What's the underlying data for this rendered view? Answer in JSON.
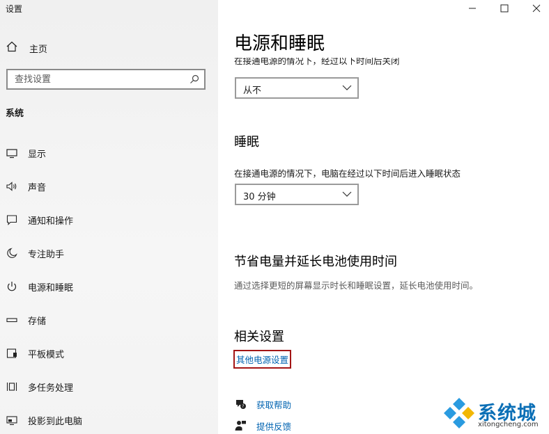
{
  "window": {
    "title": "设置"
  },
  "sidebar": {
    "home_label": "主页",
    "search_placeholder": "查找设置",
    "section_title": "系统",
    "items": [
      {
        "label": "显示",
        "icon": "display-icon"
      },
      {
        "label": "声音",
        "icon": "speaker-icon"
      },
      {
        "label": "通知和操作",
        "icon": "notification-icon"
      },
      {
        "label": "专注助手",
        "icon": "moon-icon"
      },
      {
        "label": "电源和睡眠",
        "icon": "power-icon"
      },
      {
        "label": "存储",
        "icon": "storage-icon"
      },
      {
        "label": "平板模式",
        "icon": "tablet-icon"
      },
      {
        "label": "多任务处理",
        "icon": "multitask-icon"
      },
      {
        "label": "投影到此电脑",
        "icon": "project-icon"
      }
    ]
  },
  "main": {
    "title": "电源和睡眠",
    "screen_desc_cut": "在接通电源的情况下，经过以下时间后关闭",
    "screen_select": "从不",
    "sleep_heading": "睡眠",
    "sleep_desc": "在接通电源的情况下，电脑在经过以下时间后进入睡眠状态",
    "sleep_select": "30 分钟",
    "battery_heading": "节省电量并延长电池使用时间",
    "battery_desc": "通过选择更短的屏幕显示时长和睡眠设置，延长电池使用时间。",
    "related_heading": "相关设置",
    "related_link": "其他电源设置",
    "help_label": "获取帮助",
    "feedback_label": "提供反馈"
  },
  "watermark": {
    "brand": "系统城",
    "url": "xitongcheng.com"
  },
  "colors": {
    "link": "#0063b1",
    "highlight_border": "#a31515",
    "sidebar_bg": "#f2f2f2",
    "watermark_blue": "#0b6fb6"
  }
}
